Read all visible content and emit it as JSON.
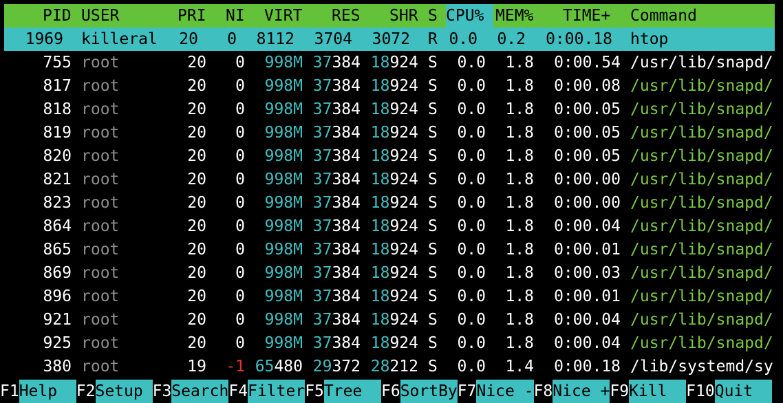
{
  "header": {
    "pid": "PID",
    "user": "USER",
    "pri": "PRI",
    "ni": "NI",
    "virt": "VIRT",
    "res": "RES",
    "shr": "SHR",
    "s": "S",
    "cpu": "CPU%",
    "mem": "MEM%",
    "time": "TIME+",
    "command": "Command"
  },
  "processes": [
    {
      "pid": "1969",
      "user": "killeral",
      "pri": "20",
      "ni": "0",
      "virt": "8112",
      "res": "3704",
      "shr": "3072",
      "s": "R",
      "cpu": "0.0",
      "mem": "0.2",
      "time": "0:00.18",
      "command": "htop"
    },
    {
      "pid": "755",
      "user": "root",
      "pri": "20",
      "ni": "0",
      "virt": "998M",
      "res_hi": "37",
      "res_lo": "384",
      "shr_hi": "18",
      "shr_lo": "924",
      "s": "S",
      "cpu": "0.0",
      "mem": "1.8",
      "time": "0:00.54",
      "command": "/usr/lib/snapd/"
    },
    {
      "pid": "817",
      "user": "root",
      "pri": "20",
      "ni": "0",
      "virt": "998M",
      "res_hi": "37",
      "res_lo": "384",
      "shr_hi": "18",
      "shr_lo": "924",
      "s": "S",
      "cpu": "0.0",
      "mem": "1.8",
      "time": "0:00.08",
      "command": "/usr/lib/snapd/"
    },
    {
      "pid": "818",
      "user": "root",
      "pri": "20",
      "ni": "0",
      "virt": "998M",
      "res_hi": "37",
      "res_lo": "384",
      "shr_hi": "18",
      "shr_lo": "924",
      "s": "S",
      "cpu": "0.0",
      "mem": "1.8",
      "time": "0:00.05",
      "command": "/usr/lib/snapd/"
    },
    {
      "pid": "819",
      "user": "root",
      "pri": "20",
      "ni": "0",
      "virt": "998M",
      "res_hi": "37",
      "res_lo": "384",
      "shr_hi": "18",
      "shr_lo": "924",
      "s": "S",
      "cpu": "0.0",
      "mem": "1.8",
      "time": "0:00.05",
      "command": "/usr/lib/snapd/"
    },
    {
      "pid": "820",
      "user": "root",
      "pri": "20",
      "ni": "0",
      "virt": "998M",
      "res_hi": "37",
      "res_lo": "384",
      "shr_hi": "18",
      "shr_lo": "924",
      "s": "S",
      "cpu": "0.0",
      "mem": "1.8",
      "time": "0:00.05",
      "command": "/usr/lib/snapd/"
    },
    {
      "pid": "821",
      "user": "root",
      "pri": "20",
      "ni": "0",
      "virt": "998M",
      "res_hi": "37",
      "res_lo": "384",
      "shr_hi": "18",
      "shr_lo": "924",
      "s": "S",
      "cpu": "0.0",
      "mem": "1.8",
      "time": "0:00.00",
      "command": "/usr/lib/snapd/"
    },
    {
      "pid": "823",
      "user": "root",
      "pri": "20",
      "ni": "0",
      "virt": "998M",
      "res_hi": "37",
      "res_lo": "384",
      "shr_hi": "18",
      "shr_lo": "924",
      "s": "S",
      "cpu": "0.0",
      "mem": "1.8",
      "time": "0:00.00",
      "command": "/usr/lib/snapd/"
    },
    {
      "pid": "864",
      "user": "root",
      "pri": "20",
      "ni": "0",
      "virt": "998M",
      "res_hi": "37",
      "res_lo": "384",
      "shr_hi": "18",
      "shr_lo": "924",
      "s": "S",
      "cpu": "0.0",
      "mem": "1.8",
      "time": "0:00.04",
      "command": "/usr/lib/snapd/"
    },
    {
      "pid": "865",
      "user": "root",
      "pri": "20",
      "ni": "0",
      "virt": "998M",
      "res_hi": "37",
      "res_lo": "384",
      "shr_hi": "18",
      "shr_lo": "924",
      "s": "S",
      "cpu": "0.0",
      "mem": "1.8",
      "time": "0:00.01",
      "command": "/usr/lib/snapd/"
    },
    {
      "pid": "869",
      "user": "root",
      "pri": "20",
      "ni": "0",
      "virt": "998M",
      "res_hi": "37",
      "res_lo": "384",
      "shr_hi": "18",
      "shr_lo": "924",
      "s": "S",
      "cpu": "0.0",
      "mem": "1.8",
      "time": "0:00.03",
      "command": "/usr/lib/snapd/"
    },
    {
      "pid": "896",
      "user": "root",
      "pri": "20",
      "ni": "0",
      "virt": "998M",
      "res_hi": "37",
      "res_lo": "384",
      "shr_hi": "18",
      "shr_lo": "924",
      "s": "S",
      "cpu": "0.0",
      "mem": "1.8",
      "time": "0:00.01",
      "command": "/usr/lib/snapd/"
    },
    {
      "pid": "921",
      "user": "root",
      "pri": "20",
      "ni": "0",
      "virt": "998M",
      "res_hi": "37",
      "res_lo": "384",
      "shr_hi": "18",
      "shr_lo": "924",
      "s": "S",
      "cpu": "0.0",
      "mem": "1.8",
      "time": "0:00.04",
      "command": "/usr/lib/snapd/"
    },
    {
      "pid": "925",
      "user": "root",
      "pri": "20",
      "ni": "0",
      "virt": "998M",
      "res_hi": "37",
      "res_lo": "384",
      "shr_hi": "18",
      "shr_lo": "924",
      "s": "S",
      "cpu": "0.0",
      "mem": "1.8",
      "time": "0:00.04",
      "command": "/usr/lib/snapd/"
    },
    {
      "pid": "380",
      "user": "root",
      "pri": "19",
      "ni": "-1",
      "virt_hi": "65",
      "virt_lo": "480",
      "res_hi": "29",
      "res_lo": "372",
      "shr_hi": "28",
      "shr_lo": "212",
      "s": "S",
      "cpu": "0.0",
      "mem": "1.4",
      "time": "0:00.18",
      "command": "/lib/systemd/sy"
    }
  ],
  "footer": [
    {
      "key": "F1",
      "label": "Help  "
    },
    {
      "key": "F2",
      "label": "Setup "
    },
    {
      "key": "F3",
      "label": "Search"
    },
    {
      "key": "F4",
      "label": "Filter"
    },
    {
      "key": "F5",
      "label": "Tree  "
    },
    {
      "key": "F6",
      "label": "SortBy"
    },
    {
      "key": "F7",
      "label": "Nice -"
    },
    {
      "key": "F8",
      "label": "Nice +"
    },
    {
      "key": "F9",
      "label": "Kill  "
    },
    {
      "key": "F10",
      "label": "Quit  "
    }
  ]
}
